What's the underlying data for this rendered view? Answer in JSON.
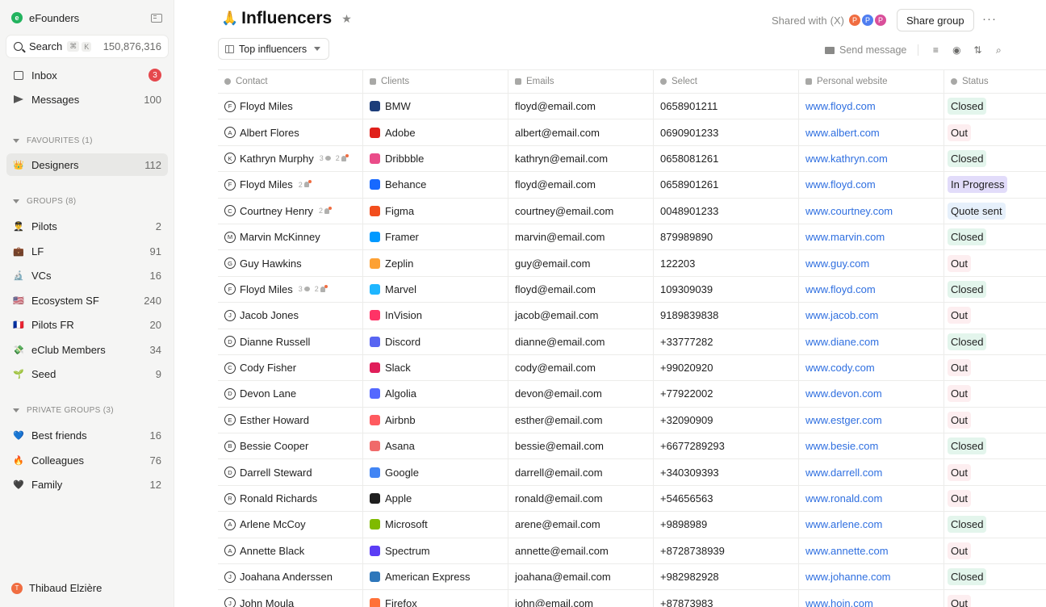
{
  "sidebar": {
    "workspace": {
      "name": "eFounders",
      "logo": "e"
    },
    "search": {
      "label": "Search",
      "kbd_cmd": "⌘",
      "kbd_k": "K",
      "count": "150,876,316"
    },
    "top_items": [
      {
        "label": "Inbox",
        "badge": "3"
      },
      {
        "label": "Messages",
        "count": "100"
      }
    ],
    "favourites_header": "FAVOURITES (1)",
    "favourites": [
      {
        "emoji": "👑",
        "label": "Designers",
        "count": "112"
      }
    ],
    "groups_header": "GROUPS (8)",
    "groups": [
      {
        "emoji": "👨‍✈️",
        "label": "Pilots",
        "count": "2"
      },
      {
        "emoji": "💼",
        "label": "LF",
        "count": "91"
      },
      {
        "emoji": "🔬",
        "label": "VCs",
        "count": "16"
      },
      {
        "emoji": "🇺🇸",
        "label": "Ecosystem SF",
        "count": "240"
      },
      {
        "emoji": "🇫🇷",
        "label": "Pilots FR",
        "count": "20"
      },
      {
        "emoji": "💸",
        "label": "eClub Members",
        "count": "34"
      },
      {
        "emoji": "🌱",
        "label": "Seed",
        "count": "9"
      }
    ],
    "private_header": "PRIVATE GROUPS (3)",
    "private_groups": [
      {
        "emoji": "💙",
        "label": "Best friends",
        "count": "16"
      },
      {
        "emoji": "🔥",
        "label": "Colleagues",
        "count": "76"
      },
      {
        "emoji": "🖤",
        "label": "Family",
        "count": "12"
      }
    ],
    "user": {
      "initial": "T",
      "name": "Thibaud Elzière"
    }
  },
  "header": {
    "emoji": "🙏",
    "title": "Influencers",
    "shared_label": "Shared with",
    "shared_x": "(X)",
    "avatars": [
      {
        "initial": "P",
        "color": "#f06d41"
      },
      {
        "initial": "P",
        "color": "#4f7ef0"
      },
      {
        "initial": "P",
        "color": "#d94f9a"
      }
    ],
    "share_button": "Share group",
    "more": "···"
  },
  "toolbar": {
    "view_name": "Top influencers",
    "send_message": "Send message"
  },
  "table": {
    "columns": [
      "Contact",
      "Clients",
      "Emails",
      "Select",
      "Personal website",
      "Status"
    ],
    "rows": [
      {
        "initial": "F",
        "name": "Floyd Miles",
        "comments": "",
        "alerts": "",
        "brand": "BMW",
        "brand_color": "#1c3d7a",
        "email": "floyd@email.com",
        "phone": "0658901211",
        "web": "www.floyd.com",
        "status": "Closed",
        "status_bg": "#e3f5ec"
      },
      {
        "initial": "A",
        "name": "Albert Flores",
        "comments": "",
        "alerts": "",
        "brand": "Adobe",
        "brand_color": "#e0201b",
        "email": "albert@email.com",
        "phone": "0690901233",
        "web": "www.albert.com",
        "status": "Out",
        "status_bg": "#fdeef0"
      },
      {
        "initial": "K",
        "name": "Kathryn Murphy",
        "comments": "3",
        "alerts": "2",
        "brand": "Dribbble",
        "brand_color": "#ea4c89",
        "email": "kathryn@email.com",
        "phone": "0658081261",
        "web": "www.kathryn.com",
        "status": "Closed",
        "status_bg": "#e3f5ec"
      },
      {
        "initial": "F",
        "name": "Floyd Miles",
        "comments": "",
        "alerts": "2",
        "brand": "Behance",
        "brand_color": "#1769ff",
        "email": "floyd@email.com",
        "phone": "0658901261",
        "web": "www.floyd.com",
        "status": "In Progress",
        "status_bg": "#e2dcfa"
      },
      {
        "initial": "C",
        "name": "Courtney Henry",
        "comments": "",
        "alerts": "2",
        "brand": "Figma",
        "brand_color": "#f24e1e",
        "email": "courtney@email.com",
        "phone": "0048901233",
        "web": "www.courtney.com",
        "status": "Quote sent",
        "status_bg": "#e6f0fb"
      },
      {
        "initial": "M",
        "name": "Marvin McKinney",
        "comments": "",
        "alerts": "",
        "brand": "Framer",
        "brand_color": "#0099ff",
        "email": "marvin@email.com",
        "phone": "879989890",
        "web": "www.marvin.com",
        "status": "Closed",
        "status_bg": "#e3f5ec"
      },
      {
        "initial": "G",
        "name": "Guy Hawkins",
        "comments": "",
        "alerts": "",
        "brand": "Zeplin",
        "brand_color": "#fda134",
        "email": "guy@email.com",
        "phone": "122203",
        "web": "www.guy.com",
        "status": "Out",
        "status_bg": "#fdeef0"
      },
      {
        "initial": "F",
        "name": "Floyd Miles",
        "comments": "3",
        "alerts": "2",
        "brand": "Marvel",
        "brand_color": "#1fb6ff",
        "email": "floyd@email.com",
        "phone": "109309039",
        "web": "www.floyd.com",
        "status": "Closed",
        "status_bg": "#e3f5ec"
      },
      {
        "initial": "J",
        "name": "Jacob Jones",
        "comments": "",
        "alerts": "",
        "brand": "InVision",
        "brand_color": "#ff3366",
        "email": "jacob@email.com",
        "phone": "9189839838",
        "web": "www.jacob.com",
        "status": "Out",
        "status_bg": "#fdeef0"
      },
      {
        "initial": "D",
        "name": "Dianne Russell",
        "comments": "",
        "alerts": "",
        "brand": "Discord",
        "brand_color": "#5865f2",
        "email": "dianne@email.com",
        "phone": "+33777282",
        "web": "www.diane.com",
        "status": "Closed",
        "status_bg": "#e3f5ec"
      },
      {
        "initial": "C",
        "name": "Cody Fisher",
        "comments": "",
        "alerts": "",
        "brand": "Slack",
        "brand_color": "#e01e5a",
        "email": "cody@email.com",
        "phone": "+99020920",
        "web": "www.cody.com",
        "status": "Out",
        "status_bg": "#fdeef0"
      },
      {
        "initial": "D",
        "name": "Devon Lane",
        "comments": "",
        "alerts": "",
        "brand": "Algolia",
        "brand_color": "#5468ff",
        "email": "devon@email.com",
        "phone": "+77922002",
        "web": "www.devon.com",
        "status": "Out",
        "status_bg": "#fdeef0"
      },
      {
        "initial": "E",
        "name": "Esther Howard",
        "comments": "",
        "alerts": "",
        "brand": "Airbnb",
        "brand_color": "#ff5a5f",
        "email": "esther@email.com",
        "phone": "+32090909",
        "web": "www.estger.com",
        "status": "Out",
        "status_bg": "#fdeef0"
      },
      {
        "initial": "B",
        "name": "Bessie Cooper",
        "comments": "",
        "alerts": "",
        "brand": "Asana",
        "brand_color": "#f06a6a",
        "email": "bessie@email.com",
        "phone": "+6677289293",
        "web": "www.besie.com",
        "status": "Closed",
        "status_bg": "#e3f5ec"
      },
      {
        "initial": "D",
        "name": "Darrell Steward",
        "comments": "",
        "alerts": "",
        "brand": "Google",
        "brand_color": "#4285f4",
        "email": "darrell@email.com",
        "phone": "+340309393",
        "web": "www.darrell.com",
        "status": "Out",
        "status_bg": "#fdeef0"
      },
      {
        "initial": "R",
        "name": "Ronald Richards",
        "comments": "",
        "alerts": "",
        "brand": "Apple",
        "brand_color": "#1f1f1f",
        "email": "ronald@email.com",
        "phone": "+54656563",
        "web": "www.ronald.com",
        "status": "Out",
        "status_bg": "#fdeef0"
      },
      {
        "initial": "A",
        "name": "Arlene McCoy",
        "comments": "",
        "alerts": "",
        "brand": "Microsoft",
        "brand_color": "#7fba00",
        "email": "arene@email.com",
        "phone": "+9898989",
        "web": "www.arlene.com",
        "status": "Closed",
        "status_bg": "#e3f5ec"
      },
      {
        "initial": "A",
        "name": "Annette Black",
        "comments": "",
        "alerts": "",
        "brand": "Spectrum",
        "brand_color": "#5b3df5",
        "email": "annette@email.com",
        "phone": "+8728738939",
        "web": "www.annette.com",
        "status": "Out",
        "status_bg": "#fdeef0"
      },
      {
        "initial": "J",
        "name": "Joahana Anderssen",
        "comments": "",
        "alerts": "",
        "brand": "American Express",
        "brand_color": "#2e77bb",
        "email": "joahana@email.com",
        "phone": "+982982928",
        "web": "www.johanne.com",
        "status": "Closed",
        "status_bg": "#e3f5ec"
      },
      {
        "initial": "J",
        "name": "John Moula",
        "comments": "",
        "alerts": "",
        "brand": "Firefox",
        "brand_color": "#ff7139",
        "email": "john@email.com",
        "phone": "+87873983",
        "web": "www.hojn.com",
        "status": "Out",
        "status_bg": "#fdeef0"
      }
    ]
  }
}
